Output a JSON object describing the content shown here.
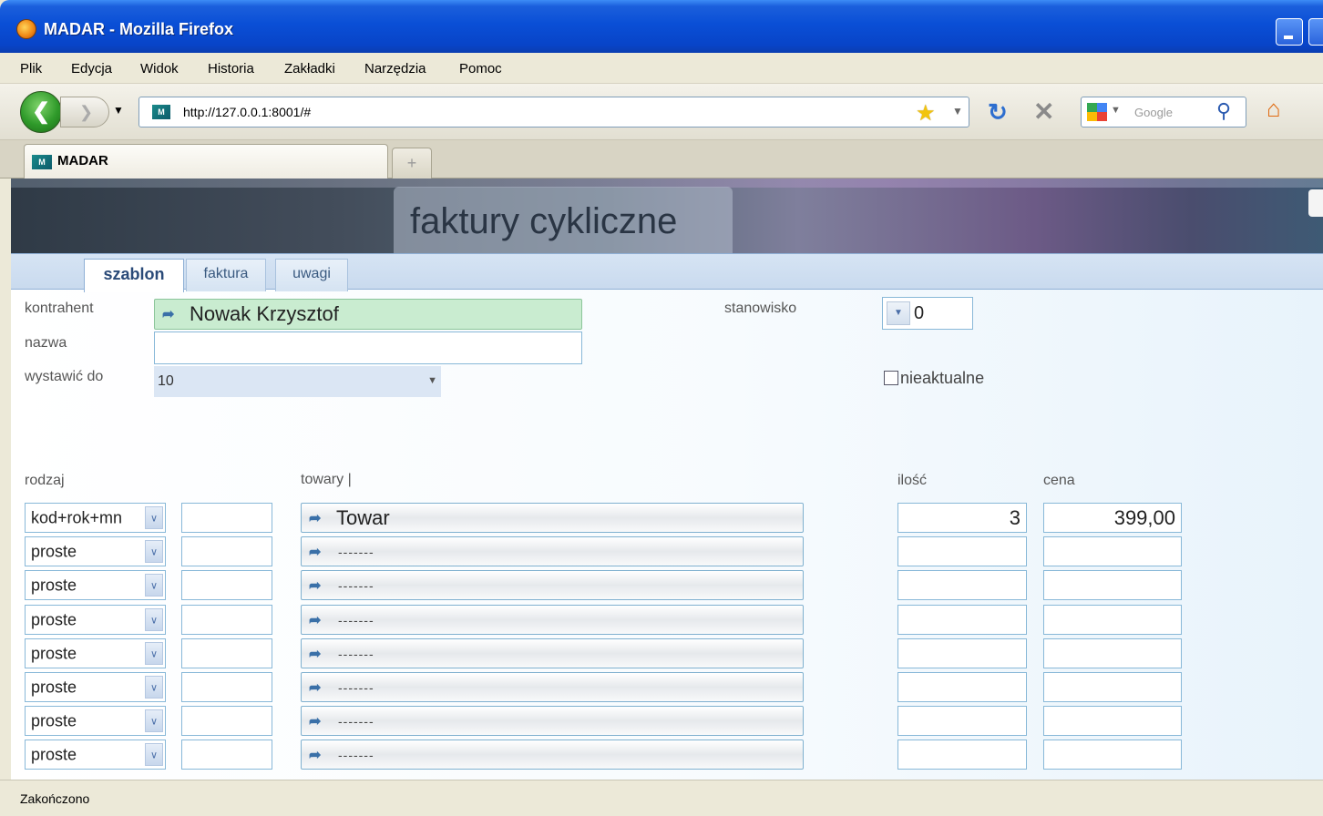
{
  "window": {
    "title": "MADAR - Mozilla Firefox"
  },
  "menu": [
    "Plik",
    "Edycja",
    "Widok",
    "Historia",
    "Zakładki",
    "Narzędzia",
    "Pomoc"
  ],
  "nav": {
    "url": "http://127.0.0.1:8001/#",
    "search_placeholder": "Google"
  },
  "browser_tab": {
    "label": "MADAR"
  },
  "page": {
    "title": "faktury cykliczne",
    "tabs": [
      "szablon",
      "faktura",
      "uwagi"
    ],
    "active_tab": "szablon",
    "form": {
      "kontrahent_label": "kontrahent",
      "kontrahent_value": "Nowak Krzysztof",
      "nazwa_label": "nazwa",
      "wystawic_label": "wystawić do",
      "wystawic_value": "10",
      "stanowisko_label": "stanowisko",
      "stanowisko_value": "0",
      "nieaktualne_label": "nieaktualne"
    },
    "grid": {
      "headers": {
        "rodzaj": "rodzaj",
        "towary": "towary |",
        "ilosc": "ilość",
        "cena": "cena"
      },
      "rows": [
        {
          "rodzaj": "kod+rok+mn",
          "towar": "Towar",
          "ilosc": "3",
          "cena": "399,00"
        },
        {
          "rodzaj": "proste",
          "towar": "-------",
          "ilosc": "",
          "cena": ""
        },
        {
          "rodzaj": "proste",
          "towar": "-------",
          "ilosc": "",
          "cena": ""
        },
        {
          "rodzaj": "proste",
          "towar": "-------",
          "ilosc": "",
          "cena": ""
        },
        {
          "rodzaj": "proste",
          "towar": "-------",
          "ilosc": "",
          "cena": ""
        },
        {
          "rodzaj": "proste",
          "towar": "-------",
          "ilosc": "",
          "cena": ""
        },
        {
          "rodzaj": "proste",
          "towar": "-------",
          "ilosc": "",
          "cena": ""
        },
        {
          "rodzaj": "proste",
          "towar": "-------",
          "ilosc": "",
          "cena": ""
        }
      ]
    }
  },
  "status": {
    "text": "Zakończono"
  },
  "colors": {
    "accent": "#0a4fd6",
    "lookup_active": "#c9ecd0",
    "field_border": "#88b8d8"
  },
  "icons": [
    "firefox-icon",
    "back-arrow-icon",
    "forward-arrow-icon",
    "bookmark-star-icon",
    "reload-icon",
    "stop-icon",
    "google-icon",
    "search-magnifier-icon",
    "home-icon",
    "lookup-arrow-icon",
    "dropdown-chevron-icon",
    "checkbox-icon"
  ]
}
